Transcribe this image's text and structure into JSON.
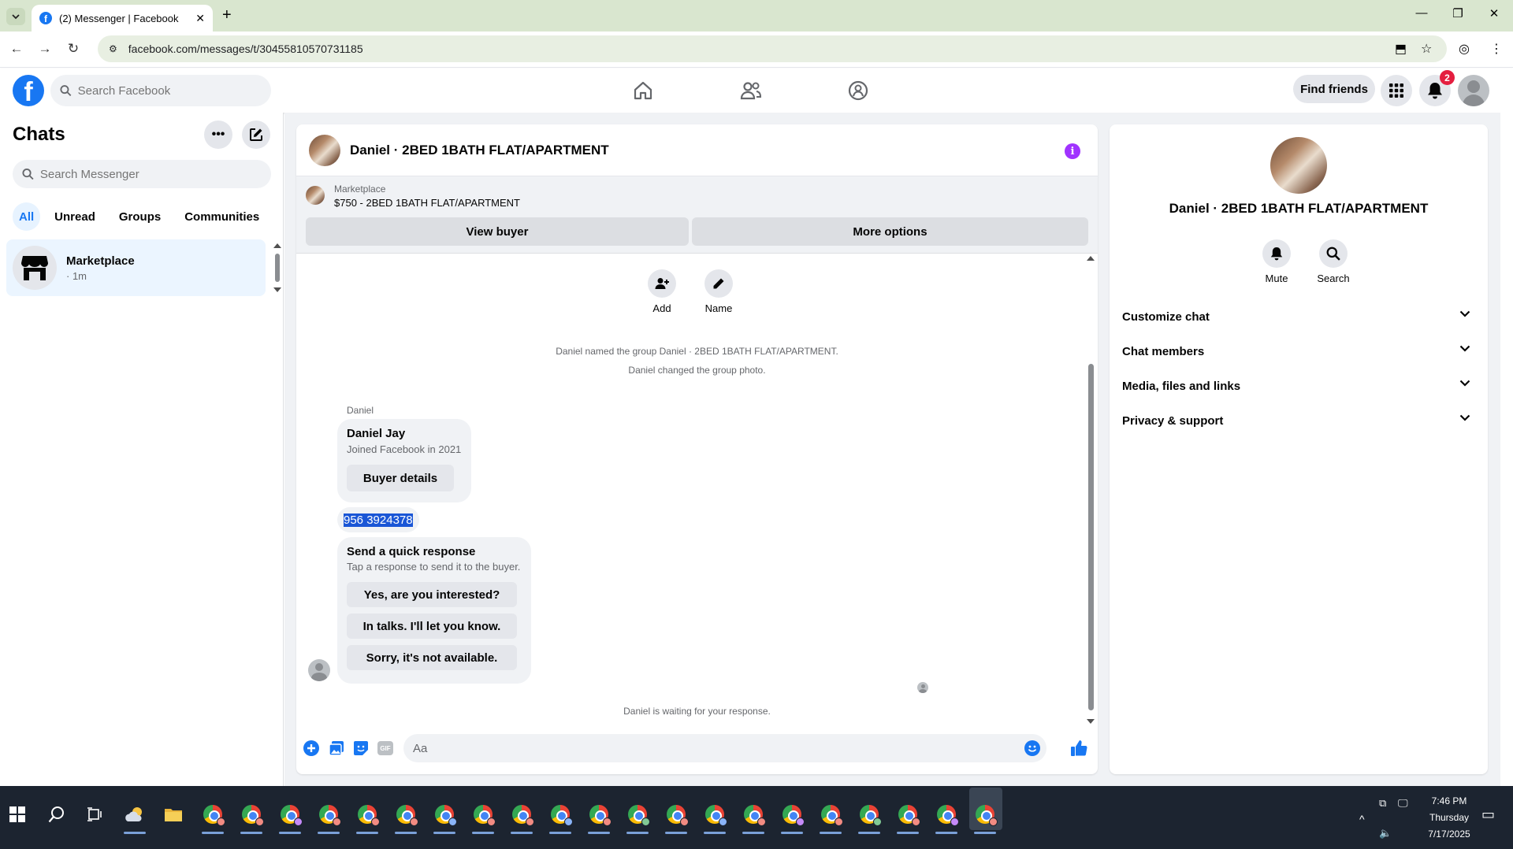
{
  "browser": {
    "tab_title": "(2) Messenger | Facebook",
    "url": "facebook.com/messages/t/30455810570731185"
  },
  "header": {
    "search_placeholder": "Search Facebook",
    "find_friends": "Find friends",
    "notification_count": "2"
  },
  "sidebar": {
    "title": "Chats",
    "search_placeholder": "Search Messenger",
    "filters": [
      "All",
      "Unread",
      "Groups",
      "Communities"
    ],
    "active_filter": "All",
    "chats": [
      {
        "name": "Marketplace",
        "time": "· 1m"
      }
    ]
  },
  "conversation": {
    "title": "Daniel · 2BED 1BATH FLAT/APARTMENT",
    "marketplace_label": "Marketplace",
    "listing": "$750 - 2BED 1BATH FLAT/APARTMENT",
    "view_buyer": "View buyer",
    "more_options": "More options",
    "actions": {
      "add": "Add",
      "name": "Name"
    },
    "system_messages": [
      "Daniel named the group Daniel · 2BED 1BATH FLAT/APARTMENT.",
      "Daniel changed the group photo."
    ],
    "sender": "Daniel",
    "buyer_card": {
      "name": "Daniel Jay",
      "joined": "Joined Facebook in 2021",
      "button": "Buyer details"
    },
    "phone_message": "956 3924378",
    "quick_response": {
      "title": "Send a quick response",
      "subtitle": "Tap a response to send it to the buyer.",
      "options": [
        "Yes, are you interested?",
        "In talks. I'll let you know.",
        "Sorry, it's not available."
      ]
    },
    "waiting": "Daniel is waiting for your response.",
    "composer_placeholder": "Aa",
    "gif_label": "GIF"
  },
  "info_panel": {
    "title": "Daniel · 2BED 1BATH FLAT/APARTMENT",
    "mute": "Mute",
    "search": "Search",
    "sections": [
      "Customize chat",
      "Chat members",
      "Media, files and links",
      "Privacy & support"
    ]
  },
  "taskbar": {
    "time": "7:46 PM",
    "day": "Thursday",
    "date": "7/17/2025"
  }
}
